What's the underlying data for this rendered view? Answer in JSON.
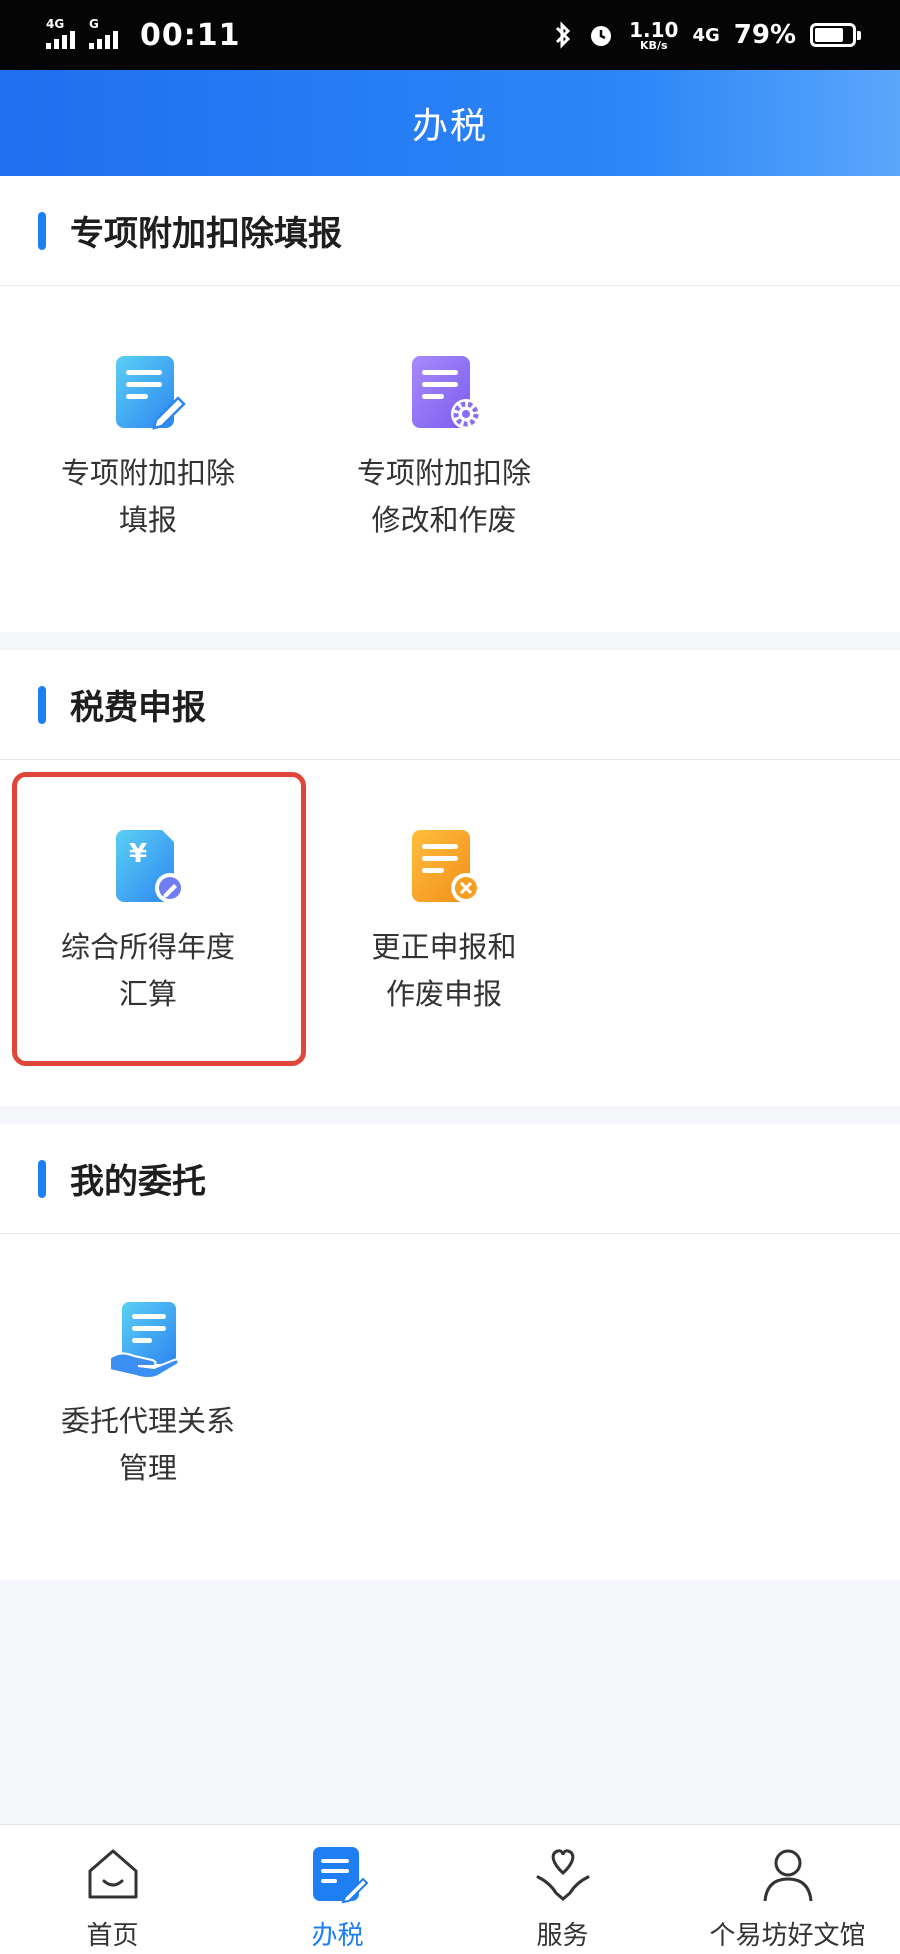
{
  "status_bar": {
    "network1": "4G",
    "network2": "G",
    "time": "00:11",
    "speed_value": "1.10",
    "speed_unit": "KB/s",
    "network3": "4G",
    "battery": "79%",
    "battery_level": 0.79
  },
  "header": {
    "title": "办税"
  },
  "sections": [
    {
      "title": "专项附加扣除填报",
      "items": [
        {
          "line1": "专项附加扣除",
          "line2": "填报",
          "icon": "doc-edit-icon"
        },
        {
          "line1": "专项附加扣除",
          "line2": "修改和作废",
          "icon": "doc-settings-icon"
        }
      ]
    },
    {
      "title": "税费申报",
      "items": [
        {
          "line1": "综合所得年度",
          "line2": "汇算",
          "icon": "yuan-doc-icon"
        },
        {
          "line1": "更正申报和",
          "line2": "作废申报",
          "icon": "doc-cancel-icon"
        }
      ]
    },
    {
      "title": "我的委托",
      "items": [
        {
          "line1": "委托代理关系",
          "line2": "管理",
          "icon": "doc-hand-icon"
        }
      ]
    }
  ],
  "bottom_nav": [
    {
      "label": "首页",
      "icon": "home-icon"
    },
    {
      "label": "办税",
      "icon": "tax-doc-icon",
      "active": true
    },
    {
      "label": "服务",
      "icon": "heart-hand-icon"
    },
    {
      "label": "个易坊好文馆",
      "icon": "person-icon"
    }
  ],
  "colors": {
    "brand_blue": "#1f7ff2",
    "highlight_red": "#e0453a",
    "orange": "#f5a023",
    "purple": "#8b6cf2"
  }
}
